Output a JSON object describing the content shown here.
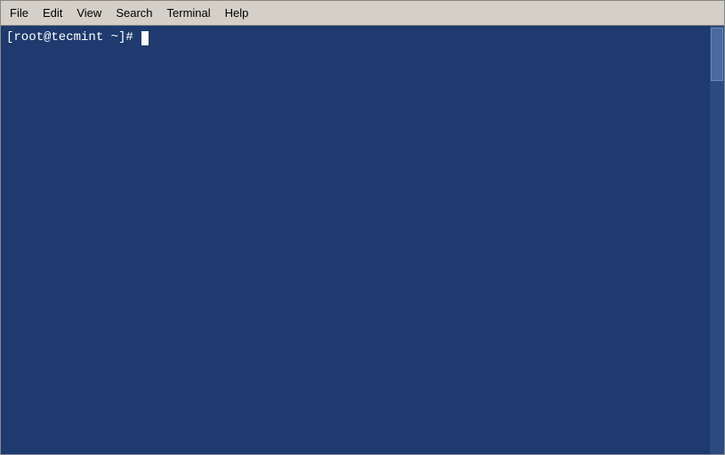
{
  "menubar": {
    "items": [
      {
        "id": "file",
        "label": "File"
      },
      {
        "id": "edit",
        "label": "Edit"
      },
      {
        "id": "view",
        "label": "View"
      },
      {
        "id": "search",
        "label": "Search"
      },
      {
        "id": "terminal",
        "label": "Terminal"
      },
      {
        "id": "help",
        "label": "Help"
      }
    ]
  },
  "terminal": {
    "prompt": "[root@tecmint ~]# "
  },
  "colors": {
    "terminal_bg": "#1e3a6e",
    "menubar_bg": "#d4d0c8",
    "text_white": "#ffffff"
  }
}
